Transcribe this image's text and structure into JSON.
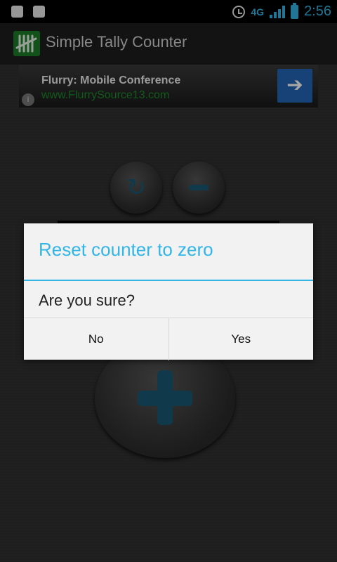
{
  "status_bar": {
    "network": "4G",
    "time": "2:56",
    "icons": [
      "notification-icon",
      "usb-icon",
      "alarm-icon",
      "signal-icon",
      "battery-icon"
    ]
  },
  "action_bar": {
    "title": "Simple Tally Counter",
    "icon": "tally-marks-icon"
  },
  "ad": {
    "title": "Flurry: Mobile Conference",
    "url": "www.FlurrySource13.com",
    "info_glyph": "i",
    "arrow_glyph": "➔"
  },
  "controls": {
    "reset_glyph": "↻",
    "accent": "#1a5a75"
  },
  "dialog": {
    "title": "Reset counter to zero",
    "message": "Are you sure?",
    "no_label": "No",
    "yes_label": "Yes",
    "accent": "#33b5e5"
  }
}
